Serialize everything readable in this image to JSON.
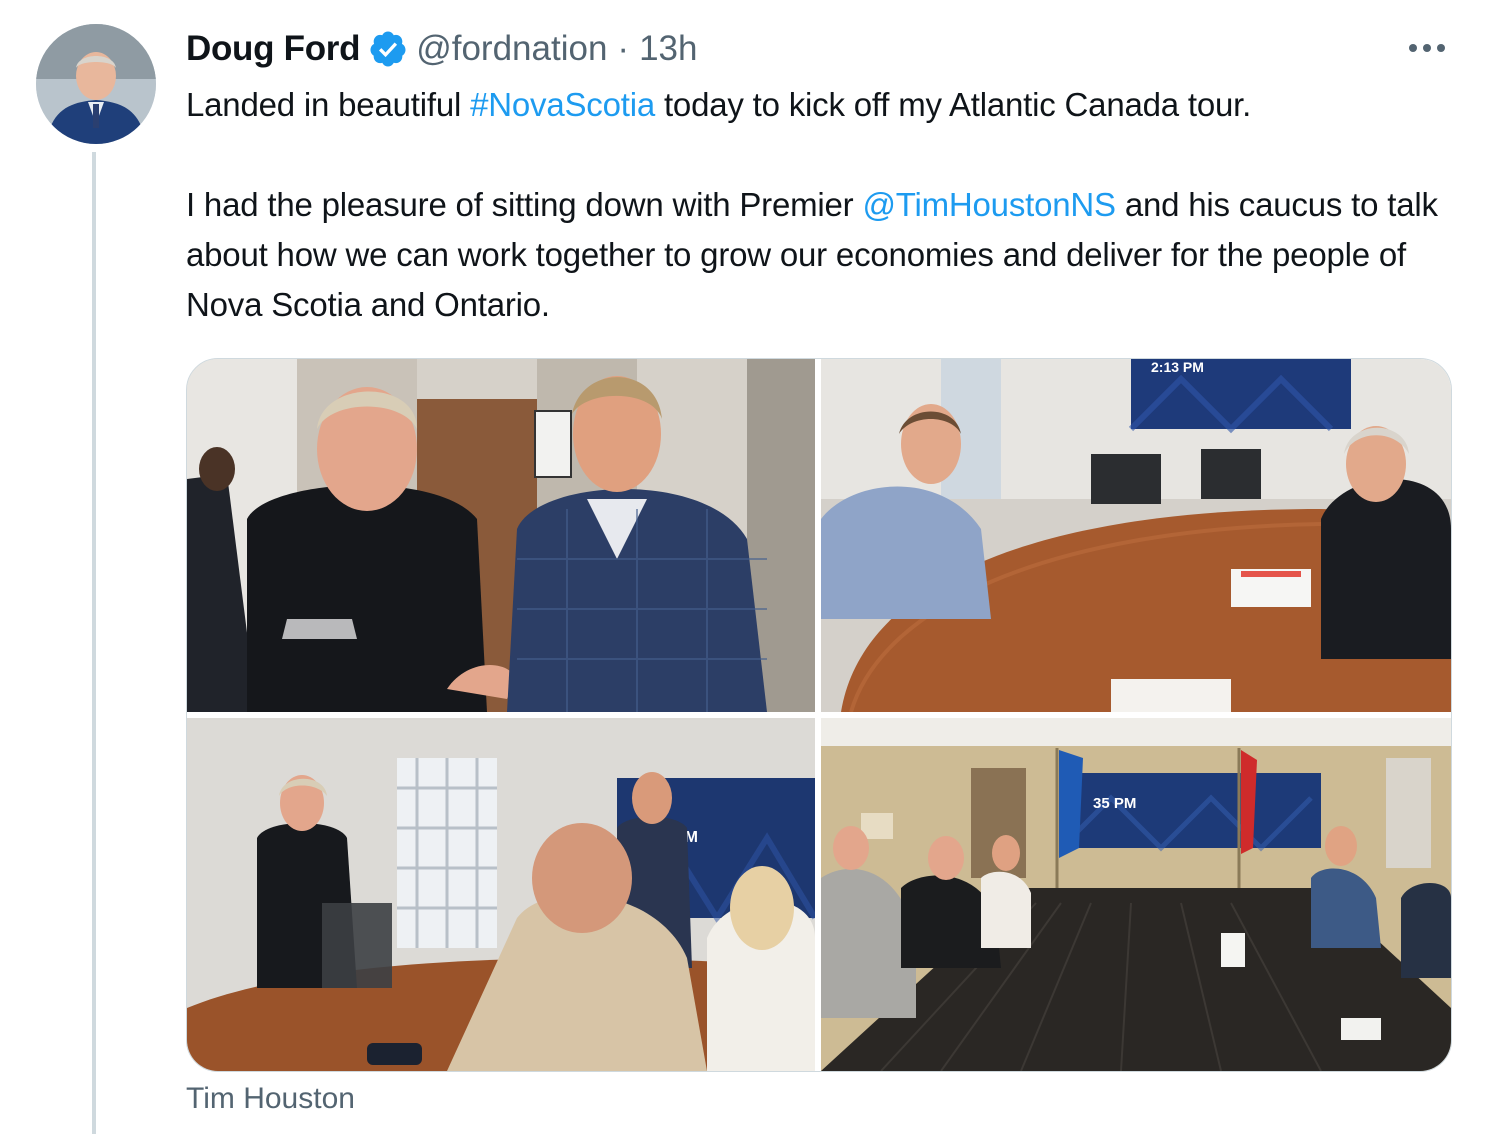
{
  "author": {
    "name": "Doug Ford",
    "handle": "@fordnation",
    "separator": "·",
    "time": "13h",
    "verified_icon": "verified-badge-icon"
  },
  "tweet": {
    "line1_before": "Landed in beautiful ",
    "hashtag": "#NovaScotia",
    "line1_after": " today to kick off my Atlantic Canada tour.",
    "para2_before": "I had the pleasure of sitting down with Premier ",
    "mention": "@TimHoustonNS",
    "para2_after": " and his caucus to talk about how we can work together to grow our economies and deliver for the people of Nova Scotia and Ontario."
  },
  "media": {
    "photo_count": 4,
    "screen_text_1": "2:13 PM",
    "screen_text_2": "PM",
    "screen_text_3": "35 PM"
  },
  "tagged_user": "Tim Houston",
  "colors": {
    "link": "#1d9bf0",
    "verified": "#1d9bf0",
    "secondary_text": "#536471",
    "border": "#cfd9de"
  }
}
